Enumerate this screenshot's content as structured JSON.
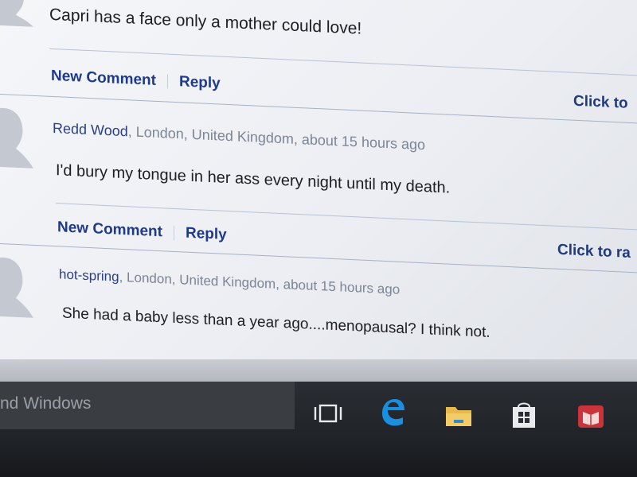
{
  "comments": [
    {
      "text": "Capri has a face only a mother could love!",
      "actions": {
        "new_comment": "New Comment",
        "reply": "Reply"
      },
      "rate_label": "Click to"
    },
    {
      "author": "Redd Wood",
      "location_time": ", London, United Kingdom, about 15 hours ago",
      "text": "I'd bury my tongue in her ass every night until my death.",
      "actions": {
        "new_comment": "New Comment",
        "reply": "Reply"
      },
      "rate_label": "Click to ra"
    },
    {
      "author": "hot-spring",
      "location_time": ", London, United Kingdom, about 15 hours ago",
      "text": "She had a baby less than a year ago....menopausal? I think not."
    }
  ],
  "taskbar": {
    "search_hint": "nd Windows",
    "icons": [
      "task-view-icon",
      "edge-browser-icon",
      "file-explorer-icon",
      "store-icon",
      "reader-icon"
    ]
  }
}
